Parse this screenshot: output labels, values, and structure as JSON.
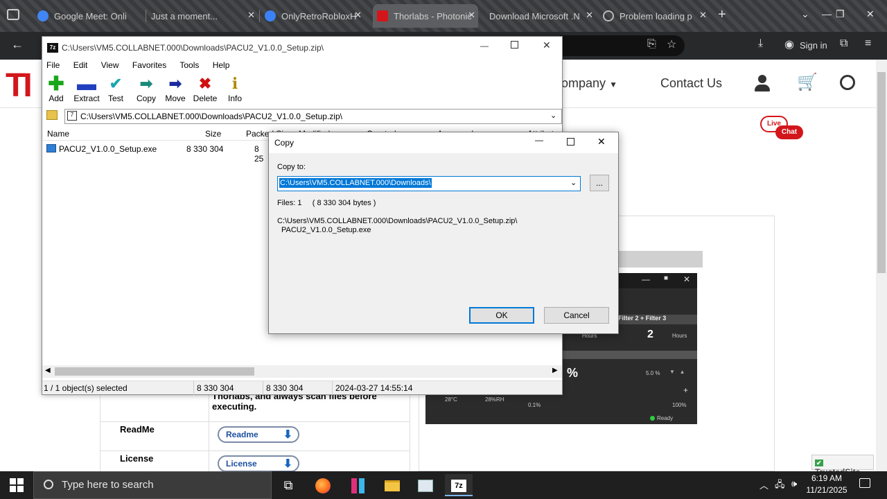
{
  "browser": {
    "tabs": [
      {
        "title": "Google Meet: Onli",
        "favicon_color": "#4285f4"
      },
      {
        "title": "Just a moment...",
        "favicon_color": "#555555"
      },
      {
        "title": "OnlyRetroRobloxH",
        "favicon_color": "#3b82f6"
      },
      {
        "title": "Thorlabs - Photonic",
        "favicon_color": "#d3161b"
      },
      {
        "title": "Download Microsoft .N",
        "favicon_color": "#555555"
      },
      {
        "title": "Problem loading p",
        "favicon_color": "#888888"
      }
    ],
    "signin_label": "Sign in"
  },
  "site": {
    "logo_text": "TI",
    "nav": {
      "company": "ompany",
      "contact": "Contact Us"
    },
    "live_chat": {
      "line1": "Live",
      "line2": "Chat"
    },
    "scan_text": "Thorlabs, and always scan files before executing.",
    "rows": [
      {
        "label": "ReadMe",
        "button": "Readme"
      },
      {
        "label": "License",
        "button": "License"
      }
    ],
    "app_preview": {
      "filter_label": "Filter 2 + Filter 3",
      "hours_value": "2",
      "hours_label": "Hours",
      "hours_left": "Hours",
      "percent_partial": "%",
      "step": "5.0 %",
      "temp": "28°C",
      "humidity": "28%RH",
      "min": "0.1%",
      "max": "100%",
      "status": "Ready"
    },
    "trusted": "TrustedSite"
  },
  "zip": {
    "title": "C:\\Users\\VM5.COLLABNET.000\\Downloads\\PACU2_V1.0.0_Setup.zip\\",
    "menu": [
      "File",
      "Edit",
      "View",
      "Favorites",
      "Tools",
      "Help"
    ],
    "toolbar": [
      {
        "label": "Add",
        "icon": "plus-icon",
        "color": "#1aa61a"
      },
      {
        "label": "Extract",
        "icon": "minus-icon",
        "color": "#1f3fbf"
      },
      {
        "label": "Test",
        "icon": "check-icon",
        "color": "#1aa6b0"
      },
      {
        "label": "Copy",
        "icon": "double-arrow-icon",
        "color": "#1a8a7a"
      },
      {
        "label": "Move",
        "icon": "arrow-right-icon",
        "color": "#1a2a9f"
      },
      {
        "label": "Delete",
        "icon": "x-icon",
        "color": "#d01010"
      },
      {
        "label": "Info",
        "icon": "info-icon",
        "color": "#b08a00"
      }
    ],
    "path": "C:\\Users\\VM5.COLLABNET.000\\Downloads\\PACU2_V1.0.0_Setup.zip\\",
    "columns": [
      "Name",
      "Size",
      "Packed Size",
      "Modified",
      "Created",
      "Accessed",
      "Attributes"
    ],
    "files": [
      {
        "name": "PACU2_V1.0.0_Setup.exe",
        "size": "8 330 304",
        "packed": "8 25"
      }
    ],
    "status": {
      "selected": "1 / 1 object(s) selected",
      "size": "8 330 304",
      "packed": "8 330 304",
      "modified": "2024-03-27 14:55:14"
    }
  },
  "copy_dialog": {
    "title": "Copy",
    "copy_to_label": "Copy to:",
    "dest": "C:\\Users\\VM5.COLLABNET.000\\Downloads\\",
    "browse": "...",
    "files_info": "Files: 1     ( 8 330 304 bytes )",
    "source_line1": "C:\\Users\\VM5.COLLABNET.000\\Downloads\\PACU2_V1.0.0_Setup.zip\\",
    "source_line2": "PACU2_V1.0.0_Setup.exe",
    "ok": "OK",
    "cancel": "Cancel"
  },
  "taskbar": {
    "search_placeholder": "Type here to search",
    "time": "6:19 AM",
    "date": "11/21/2025"
  }
}
